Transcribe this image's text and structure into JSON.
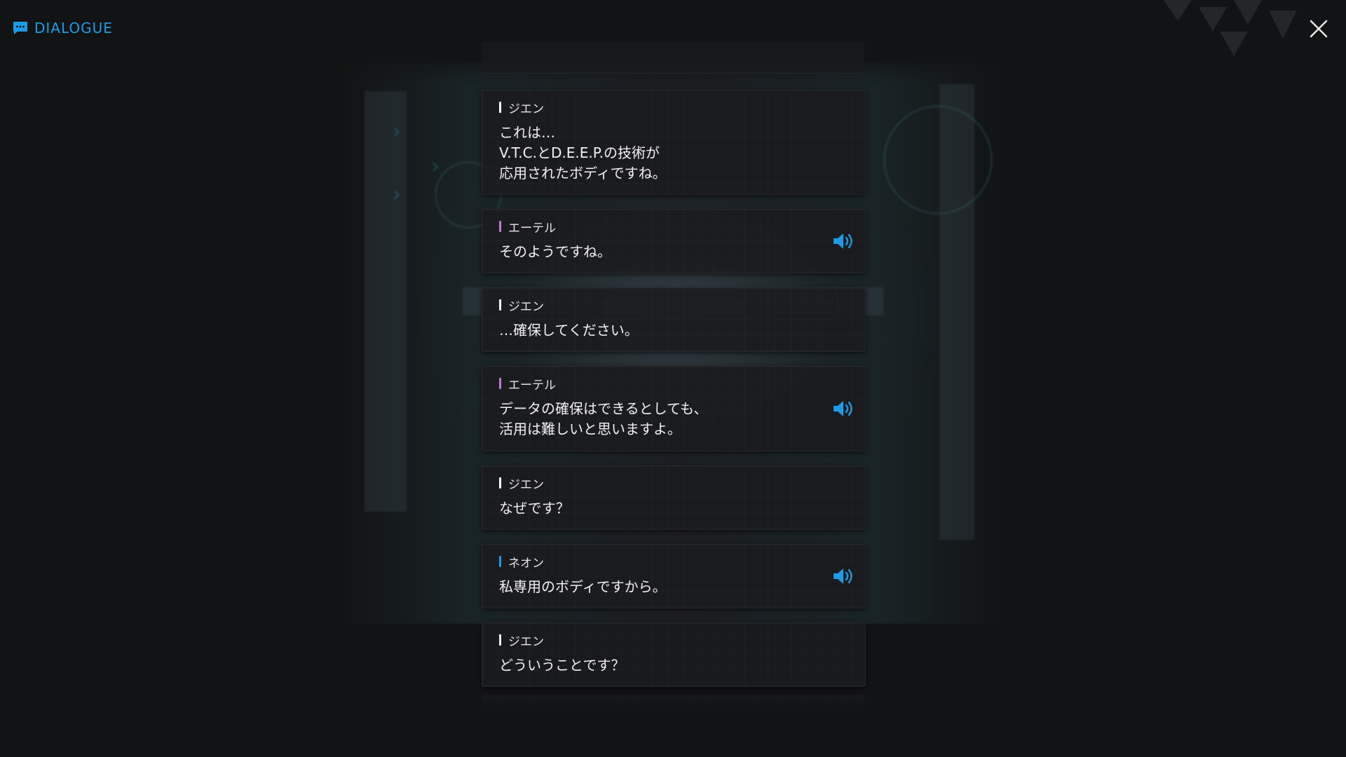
{
  "header": {
    "title": "DIALOGUE",
    "icon": "chat-bubble-icon",
    "accent_color": "#1e9be8"
  },
  "close": {
    "icon": "close-icon"
  },
  "speaker_colors": {
    "ジエン": "#ffffff",
    "エーテル": "#c07ad8",
    "ネオン": "#1e9be8"
  },
  "entries": [
    {
      "speaker": "ジエン",
      "text": "これは…\nV.T.C.とD.E.E.P.の技術が\n応用されたボディですね。",
      "has_voice": false
    },
    {
      "speaker": "エーテル",
      "text": "そのようですね。",
      "has_voice": true
    },
    {
      "speaker": "ジエン",
      "text": "…確保してください。",
      "has_voice": false
    },
    {
      "speaker": "エーテル",
      "text": "データの確保はできるとしても、\n活用は難しいと思いますよ。",
      "has_voice": true
    },
    {
      "speaker": "ジエン",
      "text": "なぜです？",
      "has_voice": false
    },
    {
      "speaker": "ネオン",
      "text": "私専用のボディですから。",
      "has_voice": true
    },
    {
      "speaker": "ジエン",
      "text": "どういうことです？",
      "has_voice": false
    }
  ]
}
